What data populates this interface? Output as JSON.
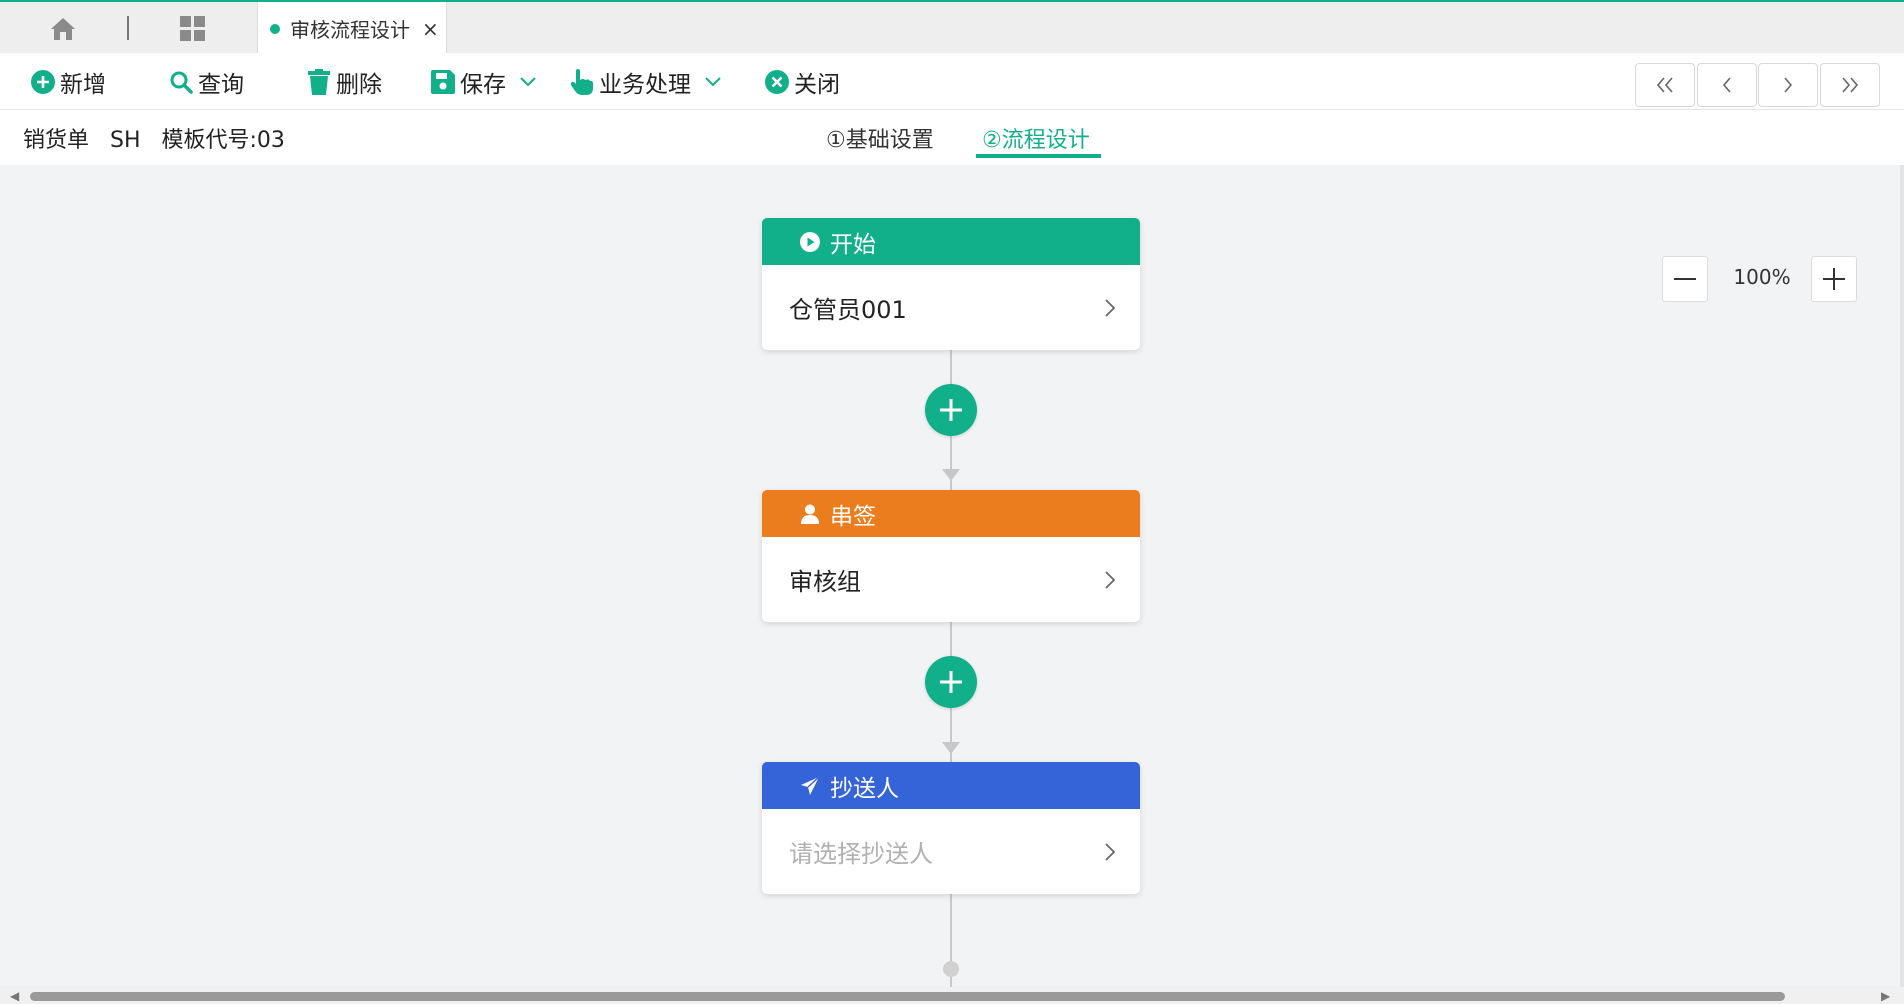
{
  "tabbar": {
    "home_icon": "home-icon",
    "apps_icon": "grid-icon",
    "active_tab": {
      "label": "审核流程设计",
      "close": "×"
    }
  },
  "toolbar": {
    "buttons": [
      {
        "label": "新增",
        "icon": "plus-circle-icon"
      },
      {
        "label": "查询",
        "icon": "search-icon"
      },
      {
        "label": "删除",
        "icon": "trash-icon"
      },
      {
        "label": "保存",
        "icon": "save-icon",
        "dropdown": true
      },
      {
        "label": "业务处理",
        "icon": "hand-pointer-icon",
        "dropdown": true
      },
      {
        "label": "关闭",
        "icon": "close-circle-icon"
      }
    ],
    "nav": [
      "«",
      "‹",
      "›",
      "»"
    ]
  },
  "infobar": {
    "meta": "销货单   SH   模板代号:03",
    "steps": [
      {
        "label": "①基础设置",
        "active": false
      },
      {
        "label": "②流程设计",
        "active": true
      }
    ]
  },
  "flow": {
    "nodes": [
      {
        "title": "开始",
        "value": "仓管员001",
        "color": "#11b08b",
        "icon": "play-circle-icon",
        "placeholder": false
      },
      {
        "title": "串签",
        "value": "审核组",
        "color": "#ec7d1f",
        "icon": "user-icon",
        "placeholder": false
      },
      {
        "title": "抄送人",
        "value": "请选择抄送人",
        "color": "#3563d8",
        "icon": "send-icon",
        "placeholder": true
      }
    ],
    "chevron": ">"
  },
  "zoom": {
    "value": "100%",
    "minus": "—",
    "plus": "+"
  },
  "colors": {
    "accent": "#11b08b",
    "orange": "#ec7d1f",
    "blue": "#3563d8"
  }
}
